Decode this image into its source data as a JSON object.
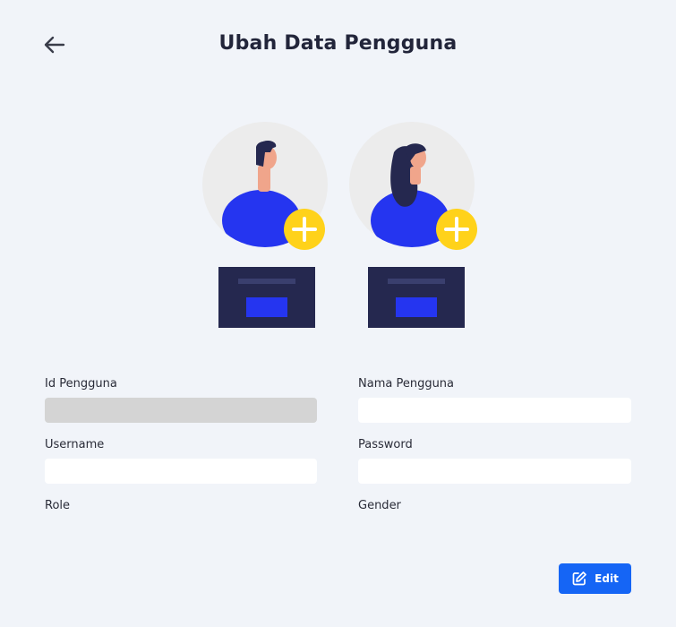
{
  "header": {
    "title": "Ubah Data Pengguna",
    "back_icon": "arrow-left-icon"
  },
  "illustration": {
    "avatar_male_icon": "male-avatar-add-icon",
    "avatar_female_icon": "female-avatar-add-icon",
    "colors": {
      "circle": "#ececec",
      "body": "#2535f0",
      "plus_badge": "#ffd21a",
      "card": "#25284f",
      "skin": "#f0a58b",
      "hair": "#25284f"
    }
  },
  "form": {
    "id_pengguna": {
      "label": "Id Pengguna",
      "value": "",
      "disabled": true
    },
    "nama_pengguna": {
      "label": "Nama Pengguna",
      "value": ""
    },
    "username": {
      "label": "Username",
      "value": ""
    },
    "password": {
      "label": "Password",
      "value": ""
    },
    "role": {
      "label": "Role"
    },
    "gender": {
      "label": "Gender"
    }
  },
  "actions": {
    "edit_label": "Edit",
    "edit_icon": "edit-icon",
    "accent": "#1565f5"
  }
}
